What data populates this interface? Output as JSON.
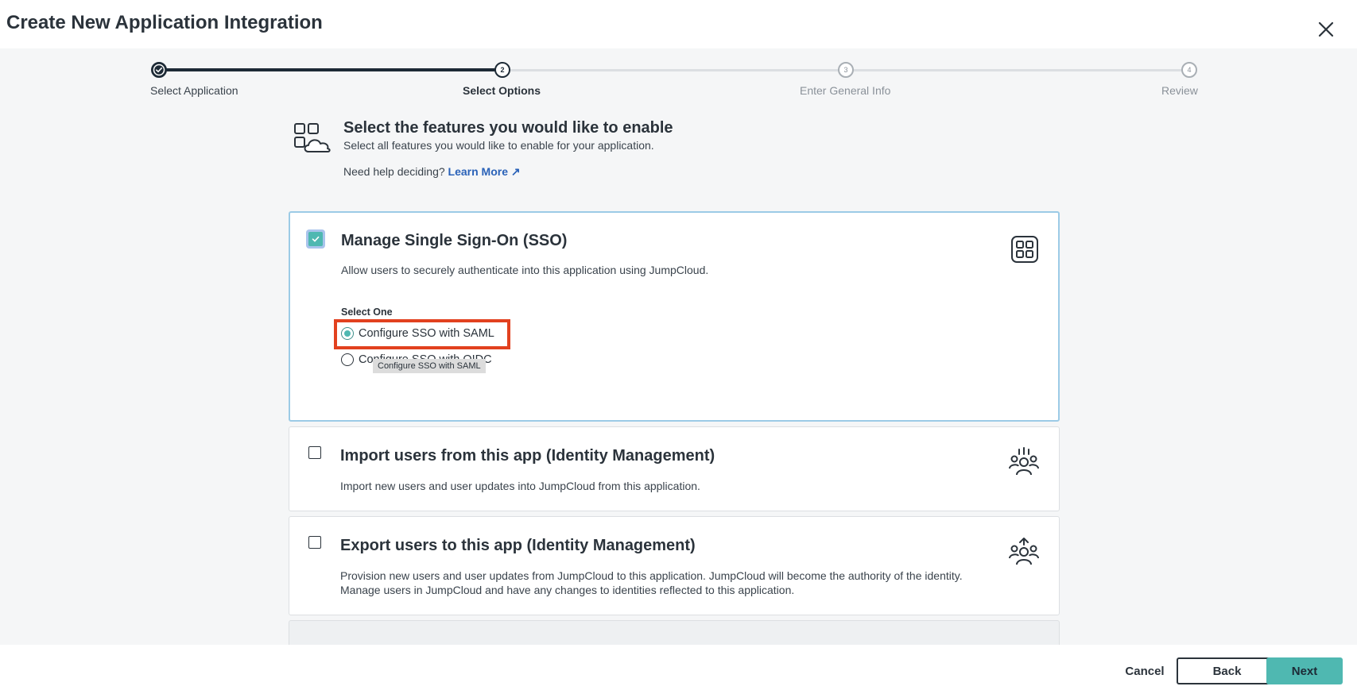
{
  "header": {
    "title": "Create New Application Integration",
    "close_icon": "close-icon"
  },
  "stepper": {
    "steps": [
      {
        "number": "1",
        "label": "Select Application",
        "state": "complete"
      },
      {
        "number": "2",
        "label": "Select Options",
        "state": "active"
      },
      {
        "number": "3",
        "label": "Enter General Info",
        "state": "pending"
      },
      {
        "number": "4",
        "label": "Review",
        "state": "pending"
      }
    ]
  },
  "intro": {
    "title": "Select the features you would like to enable",
    "subtitle": "Select all features you would like to enable for your application.",
    "help_prefix": "Need help deciding?",
    "help_link": "Learn More ↗"
  },
  "cards": {
    "sso": {
      "checked": true,
      "title": "Manage Single Sign-On (SSO)",
      "description": "Allow users to securely authenticate into this application using JumpCloud.",
      "select_label": "Select One",
      "options": [
        {
          "label": "Configure SSO with SAML",
          "selected": true
        },
        {
          "label": "Configure SSO with OIDC",
          "selected": false
        }
      ],
      "tooltip": "Configure SSO with SAML"
    },
    "import": {
      "checked": false,
      "title": "Import users from this app (Identity Management)",
      "description": "Import new users and user updates into JumpCloud from this application."
    },
    "export": {
      "checked": false,
      "title": "Export users to this app (Identity Management)",
      "description_line1": "Provision new users and user updates from JumpCloud to this application. JumpCloud will become the authority of the identity.",
      "description_line2": "Manage users in JumpCloud and have any changes to identities reflected to this application."
    }
  },
  "footer": {
    "cancel": "Cancel",
    "back": "Back",
    "next": "Next"
  },
  "colors": {
    "accent": "#4fb8b1",
    "highlight": "#e2411f",
    "link": "#2a62b8",
    "dark": "#1d2a36"
  }
}
